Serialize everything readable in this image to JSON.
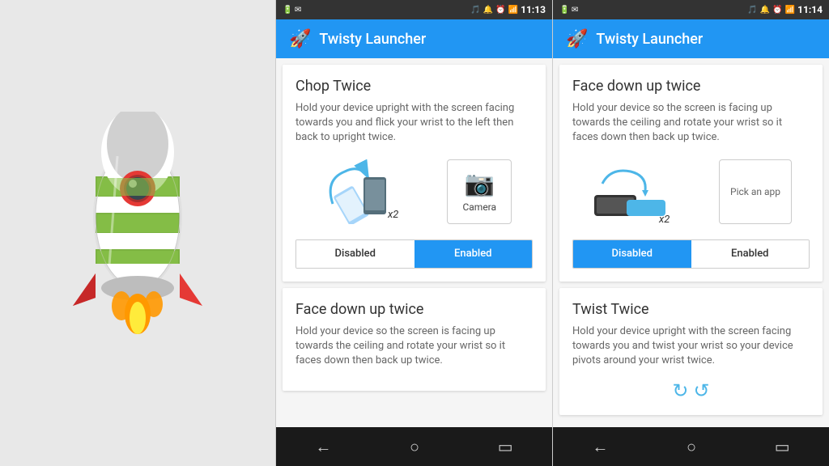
{
  "background": "#e8e8e8",
  "rocket": {
    "alt": "Rocket mascot"
  },
  "phone1": {
    "statusBar": {
      "leftIcons": "🔋📶",
      "rightIcons": "🔔 ⏰ 📶",
      "time": "11:13"
    },
    "appBar": {
      "icon": "🚀",
      "title": "Twisty Launcher"
    },
    "cards": [
      {
        "id": "chop-twice",
        "title": "Chop Twice",
        "description": "Hold your device upright with the screen facing towards you and flick your wrist to the left then back to upright twice.",
        "gesturePrimary": "phone-chop",
        "gestureSecondary": "camera",
        "gestureSecondaryLabel": "Camera",
        "x2Label": "x2",
        "toggleDisabledLabel": "Disabled",
        "toggleEnabledLabel": "Enabled",
        "toggleState": "enabled"
      },
      {
        "id": "face-down-up-twice-preview",
        "title": "Face down up twice",
        "description": "Hold your device so the screen is facing up towards the ceiling and rotate your wrist so it faces down then back up twice."
      }
    ]
  },
  "phone2": {
    "statusBar": {
      "leftIcons": "🔋📶",
      "rightIcons": "🔔 ⏰ 📶",
      "time": "11:14"
    },
    "appBar": {
      "icon": "🚀",
      "title": "Twisty Launcher"
    },
    "cards": [
      {
        "id": "face-down-up-twice",
        "title": "Face down up twice",
        "description": "Hold your device so the screen is facing up towards the ceiling and rotate your wrist so it faces down then back up twice.",
        "gesturePrimary": "face-down-phones",
        "gestureSecondary": "pick-app",
        "gestureSecondaryLabel": "Pick an app",
        "x2Label": "x2",
        "toggleDisabledLabel": "Disabled",
        "toggleEnabledLabel": "Enabled",
        "toggleState": "disabled"
      },
      {
        "id": "twist-twice",
        "title": "Twist Twice",
        "description": "Hold your device upright with the screen facing towards you and twist your wrist so your device pivots around your wrist twice."
      }
    ]
  }
}
